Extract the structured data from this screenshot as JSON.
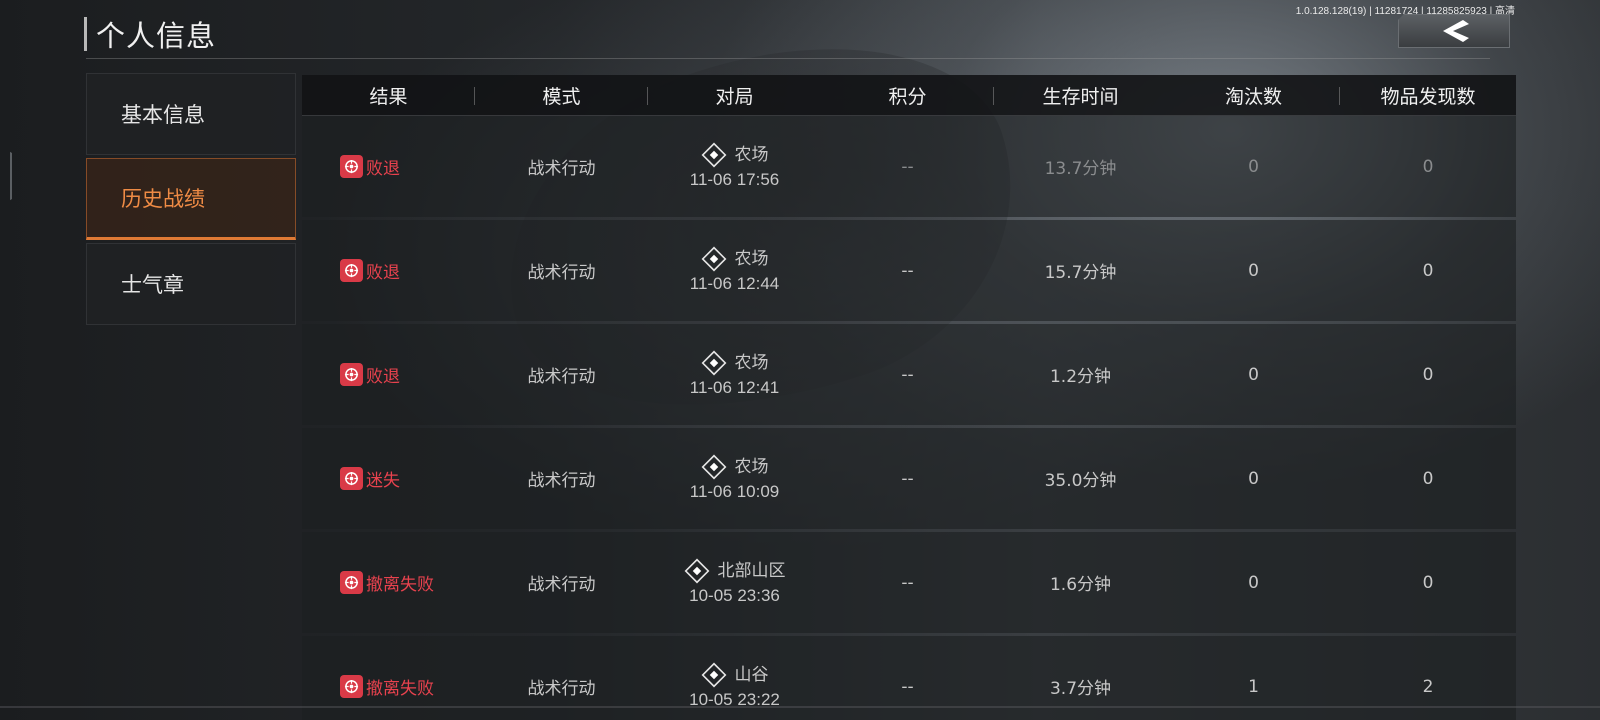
{
  "header": {
    "title": "个人信息",
    "version": "1.0.128.128(19) | 11281724 | 11285825923 | 高清",
    "back_icon": "chevron-left-icon"
  },
  "sidebar": {
    "items": [
      {
        "label": "基本信息",
        "active": false
      },
      {
        "label": "历史战绩",
        "active": true
      },
      {
        "label": "士气章",
        "active": false
      }
    ]
  },
  "table": {
    "columns": [
      "结果",
      "模式",
      "对局",
      "积分",
      "生存时间",
      "淘汰数",
      "物品发现数"
    ],
    "rows": [
      {
        "result": "败退",
        "mode": "战术行动",
        "map": "农场",
        "time": "11-06 17:56",
        "score": "--",
        "survival": "13.7分钟",
        "kills": "0",
        "items": "0"
      },
      {
        "result": "败退",
        "mode": "战术行动",
        "map": "农场",
        "time": "11-06 12:44",
        "score": "--",
        "survival": "15.7分钟",
        "kills": "0",
        "items": "0"
      },
      {
        "result": "败退",
        "mode": "战术行动",
        "map": "农场",
        "time": "11-06 12:41",
        "score": "--",
        "survival": "1.2分钟",
        "kills": "0",
        "items": "0"
      },
      {
        "result": "迷失",
        "mode": "战术行动",
        "map": "农场",
        "time": "11-06 10:09",
        "score": "--",
        "survival": "35.0分钟",
        "kills": "0",
        "items": "0"
      },
      {
        "result": "撤离失败",
        "mode": "战术行动",
        "map": "北部山区",
        "time": "10-05 23:36",
        "score": "--",
        "survival": "1.6分钟",
        "kills": "0",
        "items": "0"
      },
      {
        "result": "撤离失败",
        "mode": "战术行动",
        "map": "山谷",
        "time": "10-05 23:22",
        "score": "--",
        "survival": "3.7分钟",
        "kills": "1",
        "items": "2"
      }
    ]
  },
  "colors": {
    "accent": "#e07a35",
    "fail": "#e8424e"
  }
}
